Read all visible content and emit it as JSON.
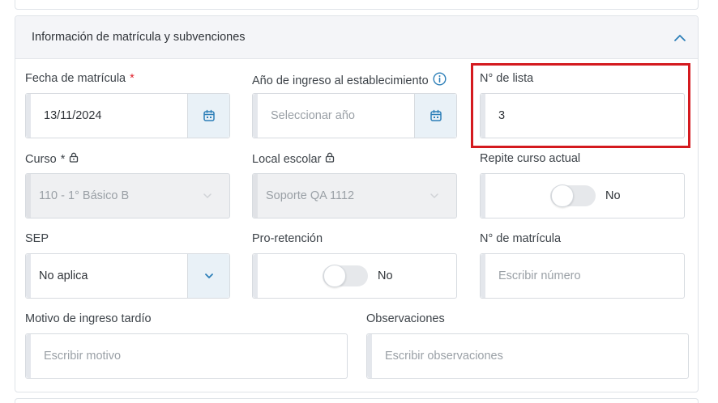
{
  "panel": {
    "title": "Información de matrícula y subvenciones"
  },
  "fields": {
    "fecha_matricula": {
      "label": "Fecha de matrícula",
      "required_mark": "*",
      "value": "13/11/2024"
    },
    "anio_ingreso": {
      "label": "Año de ingreso al establecimiento",
      "placeholder": "Seleccionar año"
    },
    "numero_lista": {
      "label": "N° de lista",
      "value": "3"
    },
    "curso": {
      "label": "Curso",
      "required_mark": "*",
      "value": "110 - 1° Básico B"
    },
    "local_escolar": {
      "label": "Local escolar",
      "value": "Soporte QA 1112"
    },
    "repite_curso": {
      "label": "Repite curso actual",
      "state": "No"
    },
    "sep": {
      "label": "SEP",
      "value": "No aplica"
    },
    "pro_retencion": {
      "label": "Pro-retención",
      "state": "No"
    },
    "numero_matricula": {
      "label": "N° de matrícula",
      "placeholder": "Escribir número"
    },
    "motivo_ingreso": {
      "label": "Motivo de ingreso tardío",
      "placeholder": "Escribir motivo"
    },
    "observaciones": {
      "label": "Observaciones",
      "placeholder": "Escribir observaciones"
    }
  },
  "colors": {
    "accent": "#2d7fb8",
    "addon_bg": "#e9f1f7",
    "required": "#e0232e",
    "highlight": "#d41a1f"
  }
}
